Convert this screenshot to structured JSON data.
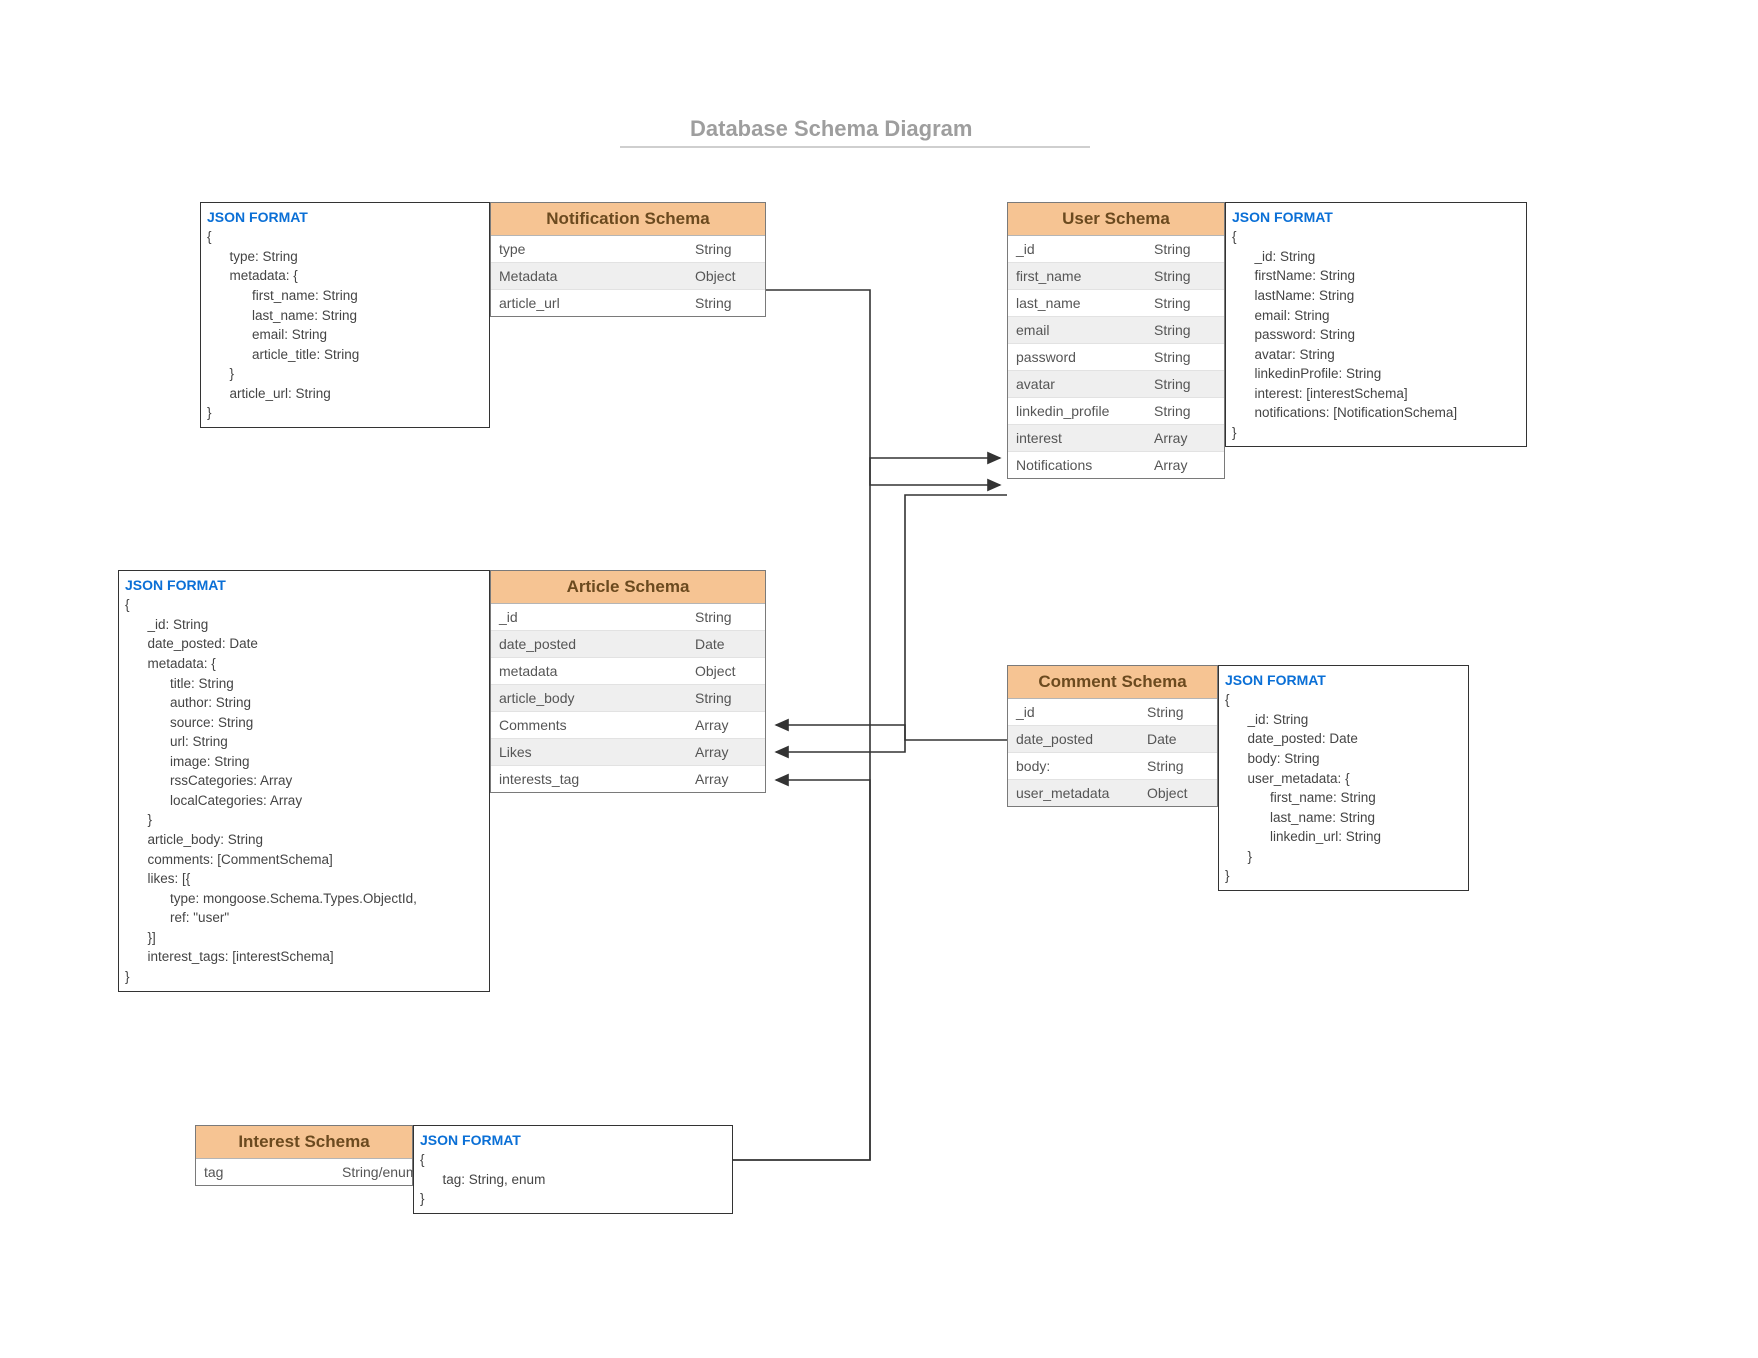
{
  "title": "Database Schema Diagram",
  "json_format_label": "JSON FORMAT",
  "schemas": {
    "notification": {
      "header": "Notification Schema",
      "rows": [
        {
          "name": "type",
          "type": "String",
          "alt": false
        },
        {
          "name": "Metadata",
          "type": "Object",
          "alt": true
        },
        {
          "name": "article_url",
          "type": "String",
          "alt": false
        }
      ]
    },
    "user": {
      "header": "User Schema",
      "rows": [
        {
          "name": "_id",
          "type": "String",
          "alt": false
        },
        {
          "name": "first_name",
          "type": "String",
          "alt": true
        },
        {
          "name": "last_name",
          "type": "String",
          "alt": false
        },
        {
          "name": "email",
          "type": "String",
          "alt": true
        },
        {
          "name": "password",
          "type": "String",
          "alt": false
        },
        {
          "name": "avatar",
          "type": "String",
          "alt": true
        },
        {
          "name": "linkedin_profile",
          "type": "String",
          "alt": false
        },
        {
          "name": "interest",
          "type": "Array",
          "alt": true
        },
        {
          "name": "Notifications",
          "type": "Array",
          "alt": false
        }
      ]
    },
    "article": {
      "header": "Article Schema",
      "rows": [
        {
          "name": "_id",
          "type": "String",
          "alt": false
        },
        {
          "name": "date_posted",
          "type": "Date",
          "alt": true
        },
        {
          "name": "metadata",
          "type": "Object",
          "alt": false
        },
        {
          "name": "article_body",
          "type": "String",
          "alt": true
        },
        {
          "name": "Comments",
          "type": "Array",
          "alt": false
        },
        {
          "name": "Likes",
          "type": "Array",
          "alt": true
        },
        {
          "name": "interests_tag",
          "type": "Array",
          "alt": false
        }
      ]
    },
    "comment": {
      "header": "Comment Schema",
      "rows": [
        {
          "name": "_id",
          "type": "String",
          "alt": false
        },
        {
          "name": "date_posted",
          "type": "Date",
          "alt": true
        },
        {
          "name": "body:",
          "type": "String",
          "alt": false
        },
        {
          "name": "user_metadata",
          "type": "Object",
          "alt": true
        }
      ]
    },
    "interest": {
      "header": "Interest Schema",
      "rows": [
        {
          "name": "tag",
          "type": "String/enum",
          "alt": false
        }
      ]
    }
  },
  "json_boxes": {
    "notification": [
      "{",
      "      type: String",
      "      metadata: {",
      "            first_name: String",
      "            last_name: String",
      "            email: String",
      "            article_title: String",
      "      }",
      "      article_url: String",
      "}"
    ],
    "user": [
      "{",
      "      _id: String",
      "      firstName: String",
      "      lastName: String",
      "      email: String",
      "      password: String",
      "      avatar: String",
      "      linkedinProfile: String",
      "      interest: [interestSchema]",
      "      notifications: [NotificationSchema]",
      "}"
    ],
    "article": [
      "{",
      "      _id: String",
      "      date_posted: Date",
      "      metadata: {",
      "            title: String",
      "            author: String",
      "            source: String",
      "            url: String",
      "            image: String",
      "            rssCategories: Array",
      "            localCategories: Array",
      "      }",
      "      article_body: String",
      "      comments: [CommentSchema]",
      "      likes: [{",
      "            type: mongoose.Schema.Types.ObjectId,",
      "            ref: \"user\"",
      "      }]",
      "      interest_tags: [interestSchema]",
      "}"
    ],
    "comment": [
      "{",
      "      _id: String",
      "      date_posted: Date",
      "      body: String",
      "      user_metadata: {",
      "            first_name: String",
      "            last_name: String",
      "            linkedin_url: String",
      "      }",
      "}"
    ],
    "interest": [
      "{",
      "      tag: String, enum",
      "}"
    ]
  }
}
